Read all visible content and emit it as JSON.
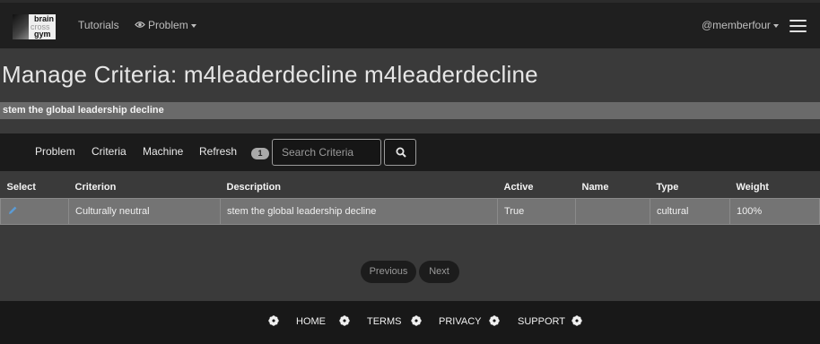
{
  "topbar": {
    "logo_text": [
      "brain",
      "cross",
      "gym"
    ],
    "tutorials": "Tutorials",
    "problem": "Problem",
    "user": "@memberfour",
    "icons": [
      "eye-icon",
      "caret-down-icon",
      "hamburger-menu-icon"
    ]
  },
  "page": {
    "title": "Manage Criteria: m4leaderdecline m4leaderdecline",
    "problem_description": "stem the global leadership decline"
  },
  "toolbar": {
    "problem": "Problem",
    "criteria": "Criteria",
    "machine": "Machine",
    "refresh": "Refresh",
    "badge_count": "1",
    "search_placeholder": "Search Criteria",
    "search_icon": "search-icon"
  },
  "table": {
    "headers": [
      "Select",
      "Criterion",
      "Description",
      "Active",
      "Name",
      "Type",
      "Weight"
    ],
    "rows": [
      {
        "select_icon": "pencil-icon",
        "criterion": "Culturally neutral",
        "description": "stem the global leadership decline",
        "active": "True",
        "name": "",
        "type": "cultural",
        "weight": "100%"
      }
    ]
  },
  "pager": {
    "previous": "Previous",
    "next": "Next"
  },
  "footer": {
    "home": "HOME",
    "terms": "TERMS",
    "privacy": "PRIVACY",
    "support": "SUPPORT",
    "separator_icon": "flower-icon"
  },
  "colors": {
    "topbar_bg": "#1f1f1f",
    "page_bg": "#3a3a3a",
    "row_bg": "#747474",
    "pencil": "#5b9bd5"
  }
}
